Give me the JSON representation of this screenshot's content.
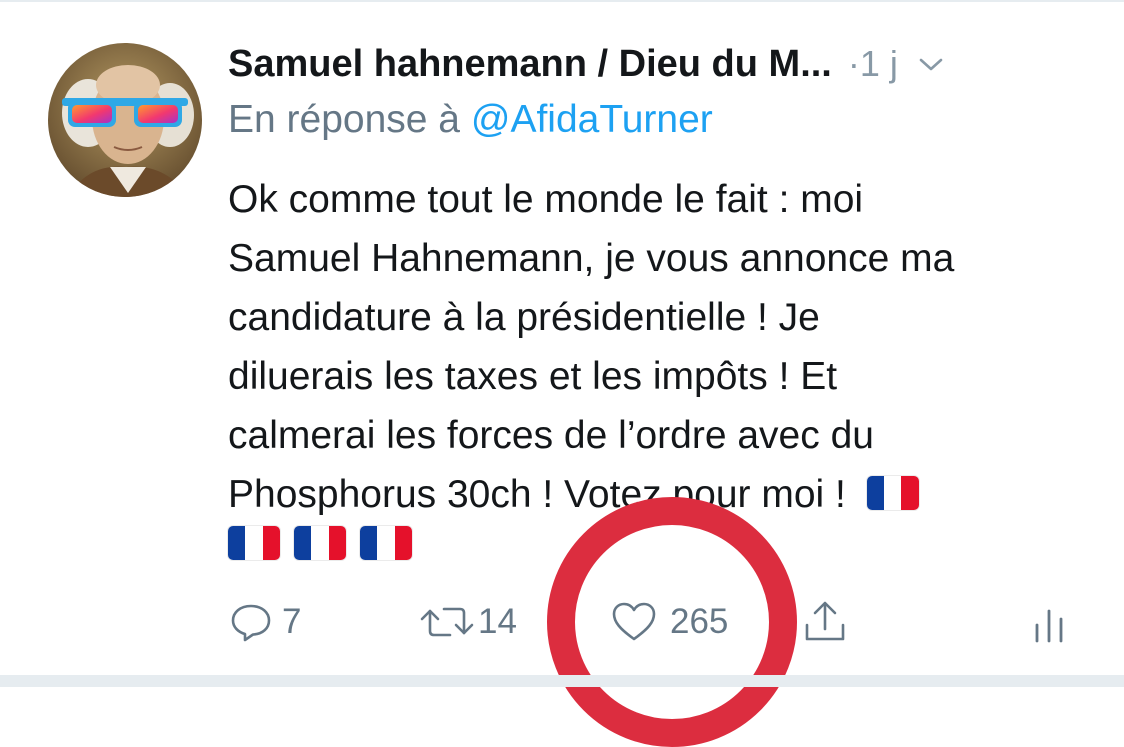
{
  "tweet": {
    "author": "Samuel hahnemann / Dieu du M...",
    "time": "·1 j",
    "reply_prefix": "En réponse à",
    "reply_handle": "@AfidaTurner",
    "lines": [
      "Ok comme tout le monde le fait : moi",
      "Samuel Hahnemann, je vous annonce ma",
      "candidature à la présidentielle ! Je",
      "diluerais les taxes et les impôts ! Et",
      "calmerai les forces de l’ordre avec du",
      "Phosphorus 30ch ! Votez pour moi !"
    ],
    "flag_count_line6": 1,
    "flag_count_line7": 3
  },
  "actions": {
    "replies": "7",
    "retweets": "14",
    "likes": "265"
  },
  "icons": {
    "avatar": "avatar-portrait",
    "caret": "chevron-down-icon",
    "reply": "reply-icon",
    "retweet": "retweet-icon",
    "like": "heart-icon",
    "share": "share-icon",
    "analytics": "analytics-icon",
    "flag": "france-flag-emoji"
  },
  "colors": {
    "text": "#14171a",
    "muted": "#657786",
    "link": "#1da1f2",
    "highlight": "#dc2d3f"
  }
}
